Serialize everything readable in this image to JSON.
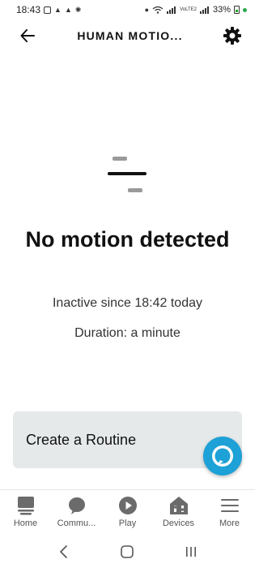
{
  "status_bar": {
    "time": "18:43",
    "battery": "33%",
    "network_label": "VoLTE2"
  },
  "header": {
    "title": "HUMAN MOTIO...",
    "back_icon": "arrow-left-icon",
    "settings_icon": "gear-icon"
  },
  "sensor": {
    "status": "No motion detected",
    "inactive": "Inactive since 18:42 today",
    "duration": "Duration: a minute"
  },
  "routine": {
    "label": "Create a Routine"
  },
  "bottom_nav": {
    "items": [
      {
        "label": "Home",
        "icon": "home-icon"
      },
      {
        "label": "Commu...",
        "icon": "chat-bubble-icon"
      },
      {
        "label": "Play",
        "icon": "play-icon"
      },
      {
        "label": "Devices",
        "icon": "devices-icon"
      },
      {
        "label": "More",
        "icon": "menu-icon"
      }
    ]
  },
  "colors": {
    "accent": "#1da1d6",
    "card_bg": "#e6e9ea",
    "icon_gray": "#6b6b6b"
  }
}
